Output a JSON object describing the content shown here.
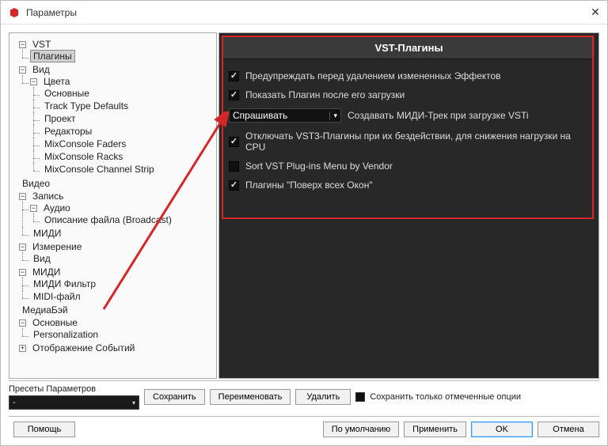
{
  "window": {
    "title": "Параметры"
  },
  "tree": {
    "vst": "VST",
    "plugins": "Плагины",
    "view": "Вид",
    "colors": "Цвета",
    "basic": "Основные",
    "track_type_defaults": "Track Type Defaults",
    "project": "Проект",
    "editors": "Редакторы",
    "mixconsole_faders": "MixConsole Faders",
    "mixconsole_racks": "MixConsole Racks",
    "mixconsole_channel_strip": "MixConsole Channel Strip",
    "video": "Видео",
    "record": "Запись",
    "audio": "Аудио",
    "broadcast": "Описание файла (Broadcast)",
    "midi": "МИДИ",
    "measurement": "Измерение",
    "view2": "Вид",
    "midi2": "МИДИ",
    "midi_filter": "МИДИ Фильтр",
    "midi_file": "MIDI-файл",
    "mediabay": "МедиаБэй",
    "basic2": "Основные",
    "personalization": "Personalization",
    "event_display": "Отображение Событий"
  },
  "panel": {
    "header": "VST-Плагины",
    "opt1": "Предупреждать перед удалением измененных Эффектов",
    "opt2": "Показать Плагин после его загрузки",
    "dropdown": "Спрашивать",
    "opt3label": "Создавать МИДИ-Трек при загрузке VSTi",
    "opt4": "Отключать VST3-Плагины при их бездействии, для снижения нагрузки на CPU",
    "opt5": "Sort VST Plug-ins Menu by Vendor",
    "opt6": "Плагины \"Поверх всех Окон\""
  },
  "presets": {
    "label": "Пресеты Параметров",
    "value": "-",
    "save": "Сохранить",
    "rename": "Переименовать",
    "delete": "Удалить",
    "save_only_marked": "Сохранить только отмеченные опции"
  },
  "buttons": {
    "help": "Помощь",
    "defaults": "По умолчанию",
    "apply": "Применить",
    "ok": "OK",
    "cancel": "Отмена"
  }
}
